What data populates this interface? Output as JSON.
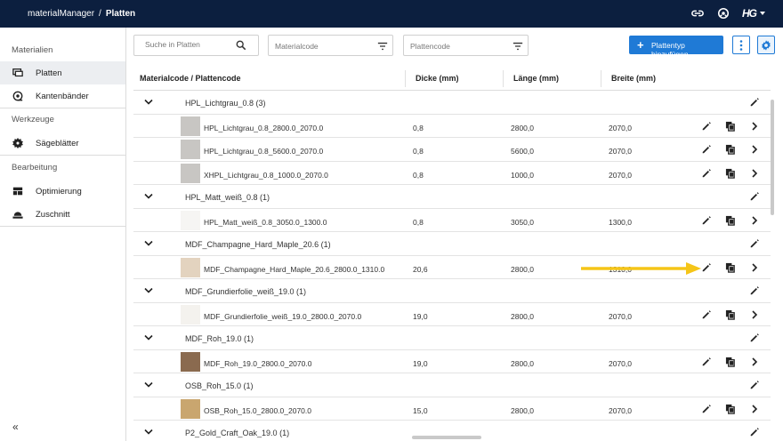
{
  "topbar": {
    "app_name": "materialManager",
    "separator": "/",
    "page_name": "Platten",
    "logo_text": "HG"
  },
  "sidebar": {
    "sections": [
      {
        "title": "Materialien",
        "items": [
          {
            "label": "Platten",
            "active": true,
            "icon": "monitor-icon"
          },
          {
            "label": "Kantenbänder",
            "active": false,
            "icon": "tape-icon"
          }
        ]
      },
      {
        "title": "Werkzeuge",
        "items": [
          {
            "label": "Sägeblätter",
            "active": false,
            "icon": "saw-blade-icon"
          }
        ]
      },
      {
        "title": "Bearbeitung",
        "items": [
          {
            "label": "Optimierung",
            "active": false,
            "icon": "layout-icon"
          },
          {
            "label": "Zuschnitt",
            "active": false,
            "icon": "cutting-icon"
          }
        ]
      }
    ],
    "collapse_label": "«"
  },
  "toolbar": {
    "search_placeholder": "Suche in Platten",
    "filter_materialcode": "Materialcode",
    "filter_plattencode": "Plattencode",
    "add_label": "Plattentyp hinzufügen"
  },
  "table": {
    "columns": [
      "Materialcode / Plattencode",
      "Dicke (mm)",
      "Länge (mm)",
      "Breite (mm)"
    ],
    "groups": [
      {
        "name": "HPL_Lichtgrau_0.8 (3)",
        "items": [
          {
            "name": "HPL_Lichtgrau_0.8_2800.0_2070.0",
            "dicke": "0,8",
            "laenge": "2800,0",
            "breite": "2070,0",
            "thumb": "#c8c6c3"
          },
          {
            "name": "HPL_Lichtgrau_0.8_5600.0_2070.0",
            "dicke": "0,8",
            "laenge": "5600,0",
            "breite": "2070,0",
            "thumb": "#c8c6c3"
          },
          {
            "name": "XHPL_Lichtgrau_0.8_1000.0_2070.0",
            "dicke": "0,8",
            "laenge": "1000,0",
            "breite": "2070,0",
            "thumb": "#c8c6c3"
          }
        ]
      },
      {
        "name": "HPL_Matt_weiß_0.8 (1)",
        "items": [
          {
            "name": "HPL_Matt_weiß_0.8_3050.0_1300.0",
            "dicke": "0,8",
            "laenge": "3050,0",
            "breite": "1300,0",
            "thumb": "#f6f5f3"
          }
        ]
      },
      {
        "name": "MDF_Champagne_Hard_Maple_20.6 (1)",
        "items": [
          {
            "name": "MDF_Champagne_Hard_Maple_20.6_2800.0_1310.0",
            "dicke": "20,6",
            "laenge": "2800,0",
            "breite": "1310,0",
            "thumb": "#e3d3bf"
          }
        ]
      },
      {
        "name": "MDF_Grundierfolie_weiß_19.0 (1)",
        "items": [
          {
            "name": "MDF_Grundierfolie_weiß_19.0_2800.0_2070.0",
            "dicke": "19,0",
            "laenge": "2800,0",
            "breite": "2070,0",
            "thumb": "#f4f2ee"
          }
        ]
      },
      {
        "name": "MDF_Roh_19.0 (1)",
        "items": [
          {
            "name": "MDF_Roh_19.0_2800.0_2070.0",
            "dicke": "19,0",
            "laenge": "2800,0",
            "breite": "2070,0",
            "thumb": "#8a6a4f"
          }
        ]
      },
      {
        "name": "OSB_Roh_15.0 (1)",
        "items": [
          {
            "name": "OSB_Roh_15.0_2800.0_2070.0",
            "dicke": "15,0",
            "laenge": "2800,0",
            "breite": "2070,0",
            "thumb": "#c9a66f"
          }
        ]
      },
      {
        "name": "P2_Gold_Craft_Oak_19.0 (1)",
        "items": []
      }
    ]
  },
  "colors": {
    "topbar": "#0c1f3f",
    "accent": "#1f7ad6",
    "annotation_arrow": "#f5c518"
  }
}
